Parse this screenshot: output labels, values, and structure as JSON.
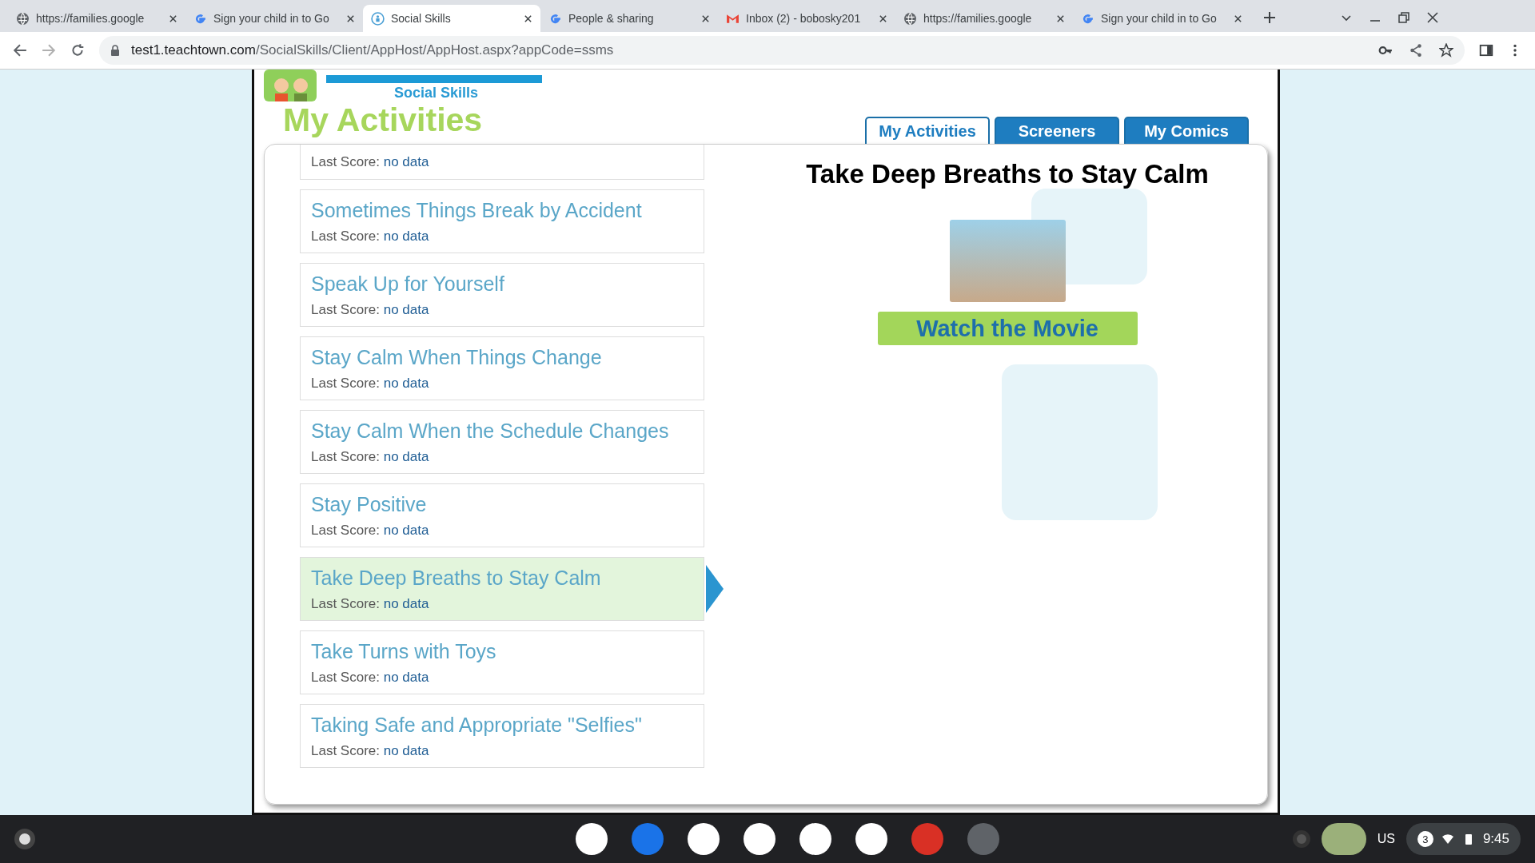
{
  "browser": {
    "tabs": [
      {
        "title": "https://families.google",
        "kind": "globe",
        "selected": false
      },
      {
        "title": "Sign your child in to Go",
        "kind": "google",
        "selected": false
      },
      {
        "title": "Social Skills",
        "kind": "app",
        "selected": true
      },
      {
        "title": "People & sharing",
        "kind": "google",
        "selected": false
      },
      {
        "title": "Inbox (2) - bobosky201",
        "kind": "gmail",
        "selected": false
      },
      {
        "title": "https://families.google",
        "kind": "globe",
        "selected": false
      },
      {
        "title": "Sign your child in to Go",
        "kind": "google",
        "selected": false
      }
    ],
    "url_host": "test1.teachtown.com",
    "url_path": "/SocialSkills/Client/AppHost/AppHost.aspx?appCode=ssms"
  },
  "app": {
    "logo_subtitle": "Social Skills",
    "heading": "My Activities",
    "nav_tabs": [
      {
        "label": "My Activities",
        "selected": true
      },
      {
        "label": "Screeners",
        "selected": false
      },
      {
        "label": "My Comics",
        "selected": false
      }
    ],
    "activities": [
      {
        "score_label": "Last Score:",
        "score": "no data",
        "selected": false
      },
      {
        "title": "Sometimes Things Break by Accident",
        "score_label": "Last Score:",
        "score": "no data",
        "selected": false
      },
      {
        "title": "Speak Up for Yourself",
        "score_label": "Last Score:",
        "score": "no data",
        "selected": false
      },
      {
        "title": "Stay Calm When Things Change",
        "score_label": "Last Score:",
        "score": "no data",
        "selected": false
      },
      {
        "title": "Stay Calm When the Schedule Changes",
        "score_label": "Last Score:",
        "score": "no data",
        "selected": false
      },
      {
        "title": "Stay Positive",
        "score_label": "Last Score:",
        "score": "no data",
        "selected": false
      },
      {
        "title": "Take Deep Breaths to Stay Calm",
        "score_label": "Last Score:",
        "score": "no data",
        "selected": true
      },
      {
        "title": "Take Turns with Toys",
        "score_label": "Last Score:",
        "score": "no data",
        "selected": false
      },
      {
        "title": "Taking Safe and Appropriate \"Selfies\"",
        "score_label": "Last Score:",
        "score": "no data",
        "selected": false
      }
    ],
    "detail": {
      "title": "Take Deep Breaths to Stay Calm",
      "button": "Watch the Movie"
    }
  },
  "taskbar": {
    "apps": [
      {
        "kind": "chrome"
      },
      {
        "kind": "files"
      },
      {
        "kind": "gmail"
      },
      {
        "kind": "docs"
      },
      {
        "kind": "docs"
      },
      {
        "kind": "hp"
      },
      {
        "kind": "game"
      },
      {
        "kind": "settings"
      }
    ],
    "keyboard": "US",
    "notifications": "3",
    "time": "9:45"
  }
}
